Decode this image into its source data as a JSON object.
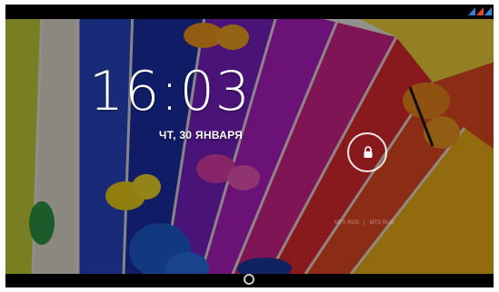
{
  "lockscreen": {
    "time": "16:03",
    "date": "ЧТ, 30 ЯНВАРЯ",
    "carrier_1": "MTS RUS",
    "carrier_sep": "|",
    "carrier_2": "MTS RUS"
  },
  "status_bar": {
    "icons": [
      "signal-icon-1",
      "signal-icon-2",
      "signal-icon-3"
    ],
    "colors": [
      "#3a7bd5",
      "#e0462b",
      "#2a8fe0"
    ]
  },
  "lock_button": {
    "icon": "lock-icon"
  },
  "navigation": {
    "home_icon": "home-icon"
  },
  "theme": {
    "wallpaper_colors": [
      "#1d3bb5",
      "#7a22c4",
      "#d21a8e",
      "#e3242b",
      "#f36c1f",
      "#f6c51a",
      "#bfd23a",
      "#f2ece0"
    ]
  }
}
